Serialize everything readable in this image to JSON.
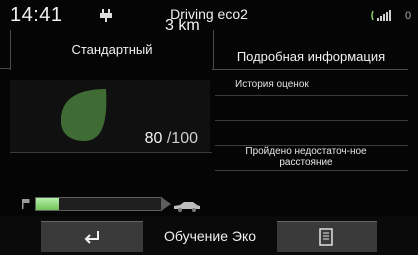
{
  "status": {
    "time": "14:41",
    "app_title": "Driving eco2",
    "edge_digit": "0",
    "icons": [
      "plug-icon",
      "signal-icon"
    ]
  },
  "tabs": [
    {
      "label": "Стандартный",
      "selected": true
    },
    {
      "label": "Подробная информация",
      "selected": false
    }
  ],
  "standard": {
    "leaf_icon": "leaf-icon",
    "leaf_color": "#3f6b34",
    "score_value": "80",
    "score_max": "/100",
    "distance_value": "3",
    "distance_unit": "km",
    "trip_progress": 0.18,
    "trip_icons": [
      "flag-icon",
      "car-icon"
    ]
  },
  "detail": {
    "history_title": "История оценок",
    "history_message": "Пройдено недостаточ-ное расстояние"
  },
  "footer": {
    "back_icon": "back-arrow-icon",
    "title": "Обучение Эко",
    "menu_icon": "document-icon"
  }
}
